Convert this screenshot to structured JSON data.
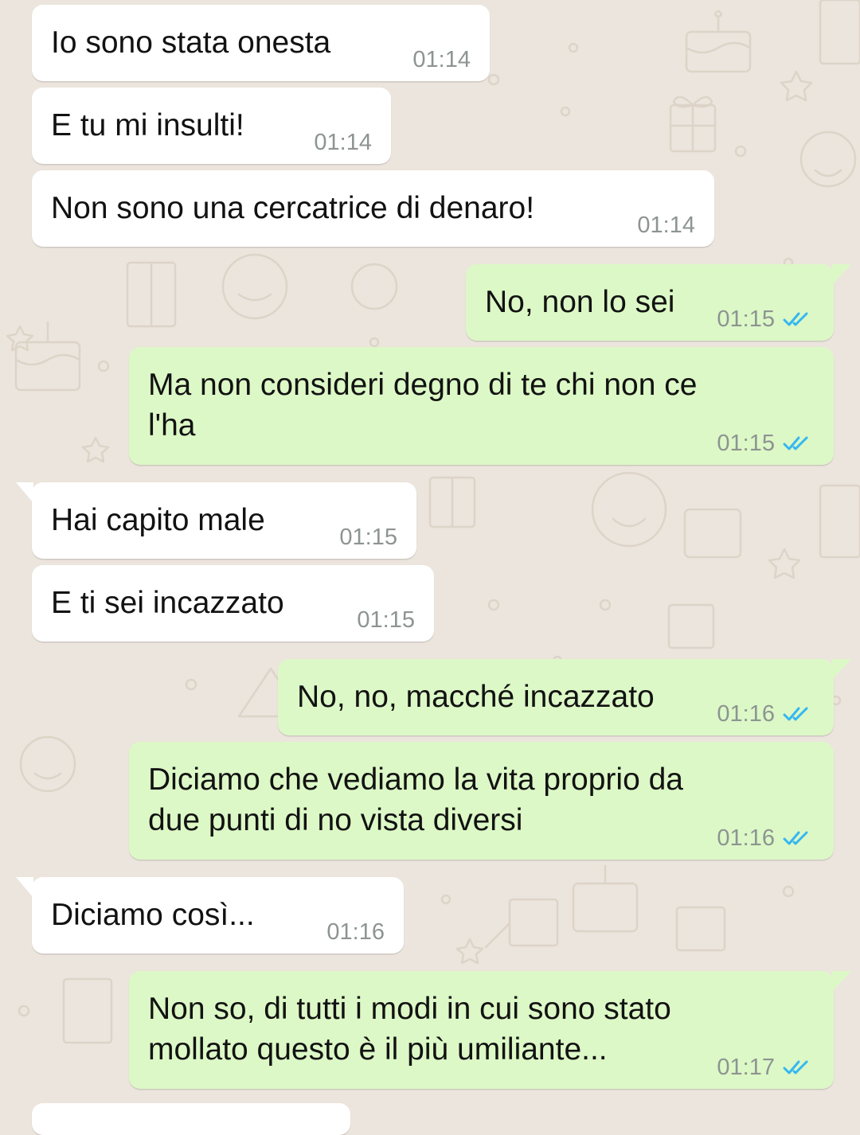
{
  "colors": {
    "wallpaper": "#ece5dd",
    "incoming_bubble": "#ffffff",
    "outgoing_bubble": "#dcf8c6",
    "time": "#8d9492",
    "read_ticks": "#34b7f1"
  },
  "icons": {
    "read_receipt": "double-check-icon"
  },
  "messages": [
    {
      "direction": "incoming",
      "text": "Io sono stata onesta",
      "time": "01:14"
    },
    {
      "direction": "incoming",
      "text": "E tu mi insulti!",
      "time": "01:14"
    },
    {
      "direction": "incoming",
      "text": "Non sono una cercatrice di denaro!",
      "time": "01:14"
    },
    {
      "direction": "outgoing",
      "text": "No, non lo sei",
      "time": "01:15",
      "status": "read"
    },
    {
      "direction": "outgoing",
      "text": "Ma non consideri degno di te chi non ce\nl'ha",
      "time": "01:15",
      "status": "read"
    },
    {
      "direction": "incoming",
      "text": "Hai capito male",
      "time": "01:15"
    },
    {
      "direction": "incoming",
      "text": "E ti sei incazzato",
      "time": "01:15"
    },
    {
      "direction": "outgoing",
      "text": "No, no, macché incazzato",
      "time": "01:16",
      "status": "read"
    },
    {
      "direction": "outgoing",
      "text": "Diciamo che vediamo la vita proprio da\ndue punti di no vista diversi",
      "time": "01:16",
      "status": "read"
    },
    {
      "direction": "incoming",
      "text": "Diciamo così...",
      "time": "01:16"
    },
    {
      "direction": "outgoing",
      "text": "Non so, di tutti i modi in cui sono stato\nmollato questo è il più umiliante...",
      "time": "01:17",
      "status": "read"
    }
  ]
}
